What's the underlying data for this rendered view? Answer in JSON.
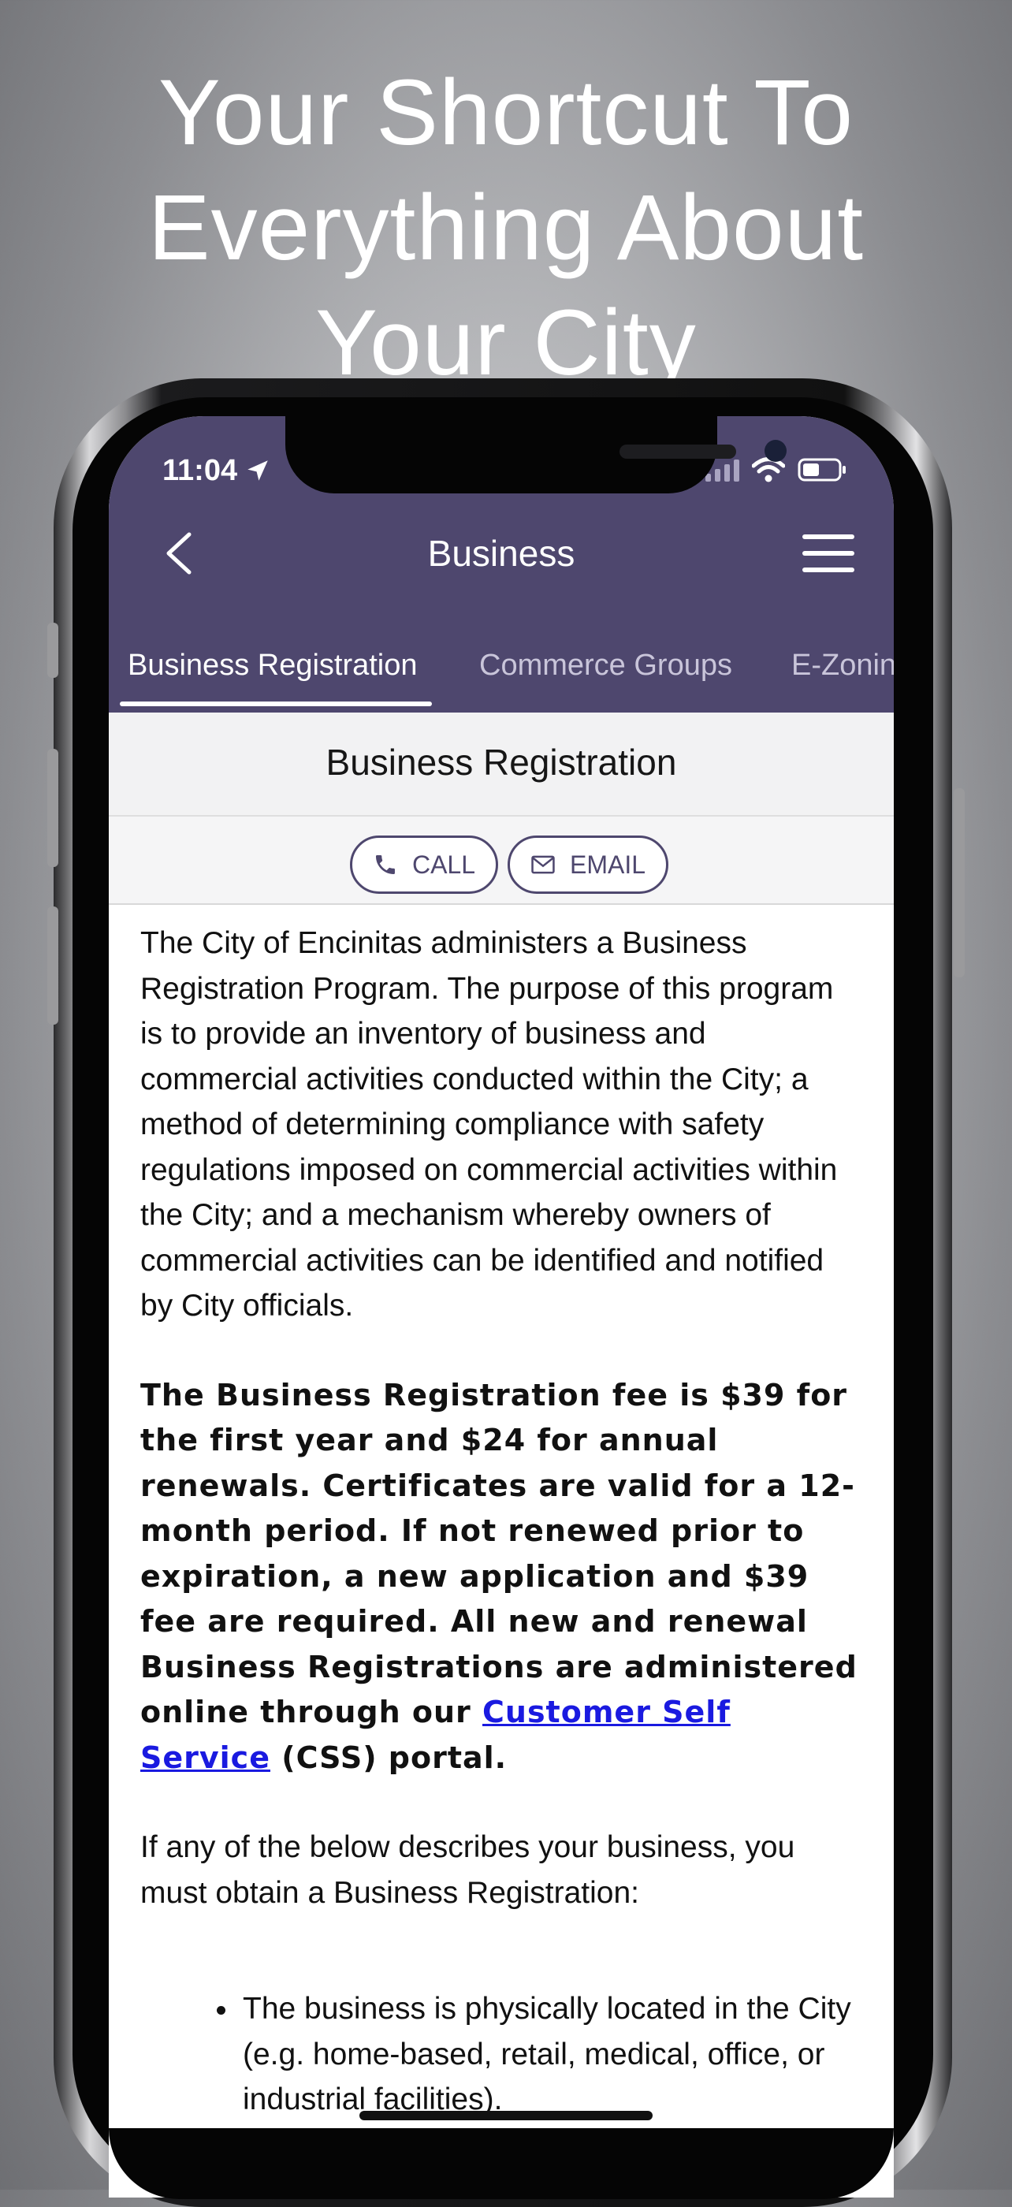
{
  "headline": {
    "line1": "Your Shortcut To",
    "line2": "Everything About",
    "line3": "Your City"
  },
  "status_bar": {
    "time": "11:04",
    "location_icon": "location-arrow-icon",
    "signal_icon": "signal-bars-icon",
    "wifi_icon": "wifi-icon",
    "battery_icon": "battery-icon"
  },
  "nav": {
    "title": "Business",
    "back_icon": "chevron-left-icon",
    "menu_icon": "hamburger-menu-icon"
  },
  "tabs": [
    {
      "label": "Business Registration",
      "active": true
    },
    {
      "label": "Commerce Groups",
      "active": false
    },
    {
      "label": "E-Zonin",
      "active": false
    }
  ],
  "section": {
    "title": "Business Registration"
  },
  "actions": {
    "call_label": "CALL",
    "email_label": "EMAIL",
    "call_icon": "phone-icon",
    "email_icon": "envelope-icon"
  },
  "content": {
    "paragraph1": "The City of Encinitas administers a Business Registration Program. The purpose of this program is to provide an inventory of business and commercial activities conducted within the City; a method of determining compliance with safety regulations imposed on commercial activities within the City; and a mechanism whereby owners of commercial activities can be identified and notified by City officials.",
    "paragraph2_before_link": "The Business Registration fee is $39 for the first year and $24 for annual renewals. Certificates are valid for a 12-month period. If not renewed prior to expiration, a new application and $39 fee are required.  All new and renewal Business Registrations are administered online through our ",
    "paragraph2_link": "Customer Self Service",
    "paragraph2_after_link": " (CSS) portal.",
    "paragraph3": "If any of the below describes your business, you must obtain a Business Registration:",
    "bullets": [
      "The business is physically located in the City (e.g. home-based, retail, medical, office, or industrial facilities)."
    ]
  },
  "colors": {
    "brand_purple": "#4e476e",
    "link_blue": "#1a1ae0"
  }
}
